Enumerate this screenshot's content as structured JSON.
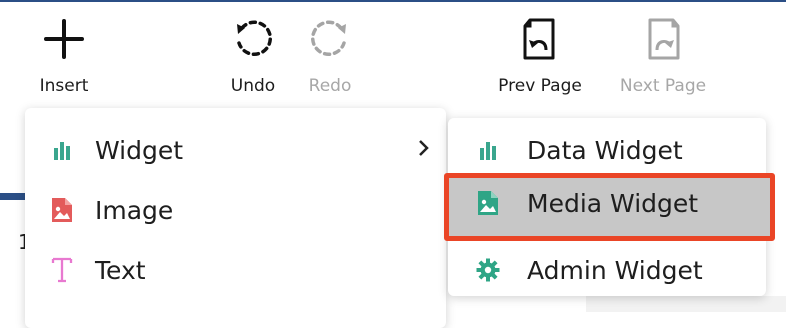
{
  "toolbar": {
    "insert_label": "Insert",
    "undo_label": "Undo",
    "redo_label": "Redo",
    "prev_page_label": "Prev Page",
    "next_page_label": "Next Page"
  },
  "background": {
    "partial_text": "1"
  },
  "insert_menu": {
    "items": [
      {
        "label": "Widget",
        "icon": "bar-chart-icon",
        "color": "#3aa68e",
        "has_submenu": true
      },
      {
        "label": "Image",
        "icon": "image-file-icon",
        "color": "#e35b5b"
      },
      {
        "label": "Text",
        "icon": "text-t-icon",
        "color": "#e879d0"
      }
    ]
  },
  "widget_submenu": {
    "items": [
      {
        "label": "Data Widget",
        "icon": "bar-chart-icon",
        "color": "#3aa68e"
      },
      {
        "label": "Media Widget",
        "icon": "image-file-icon",
        "color": "#2fa586",
        "highlighted": true
      },
      {
        "label": "Admin Widget",
        "icon": "gear-icon",
        "color": "#2fa586"
      }
    ]
  },
  "colors": {
    "highlight_border": "#ea4526",
    "highlight_fill": "#c7c7c7",
    "top_accent": "#2b4f86"
  }
}
